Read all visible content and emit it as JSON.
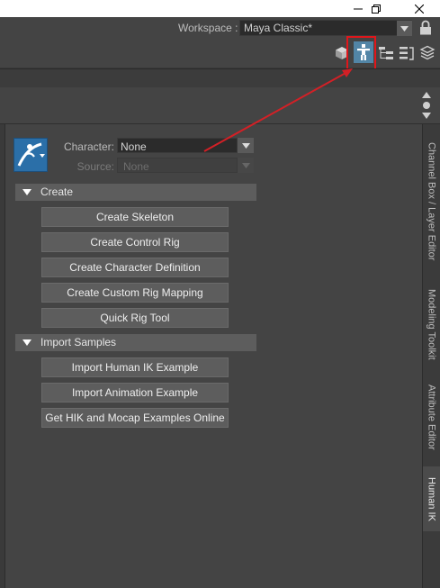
{
  "workspace": {
    "label": "Workspace :",
    "value": "Maya Classic*"
  },
  "human_ik": {
    "character_label": "Character:",
    "character_value": "None",
    "source_label": "Source:",
    "source_value": "None",
    "sections": [
      {
        "title": "Create",
        "buttons": [
          "Create Skeleton",
          "Create Control Rig",
          "Create Character Definition",
          "Create Custom Rig Mapping",
          "Quick Rig Tool"
        ]
      },
      {
        "title": "Import Samples",
        "buttons": [
          "Import Human IK Example",
          "Import Animation Example",
          "Get HIK and Mocap Examples Online"
        ]
      }
    ]
  },
  "side_tabs": [
    "Channel Box / Layer Editor",
    "Modeling Toolkit",
    "Attribute Editor",
    "Human IK"
  ],
  "colors": {
    "highlight_box": "#e0161b",
    "active_icon_bg": "#5285a6",
    "button_bg": "#5d5d5d",
    "panel_bg": "#444444"
  }
}
